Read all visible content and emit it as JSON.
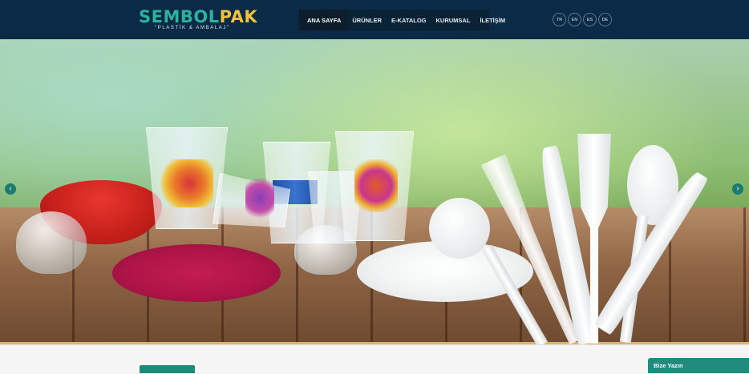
{
  "logo": {
    "name_part1": "SEMBOL",
    "name_part2": "PAK",
    "tagline": "\"PLASTİK & AMBALAJ\""
  },
  "nav": {
    "items": [
      {
        "label": "ANA SAYFA",
        "active": true
      },
      {
        "label": "ÜRÜNLER",
        "active": false
      },
      {
        "label": "E-KATALOG",
        "active": false
      },
      {
        "label": "KURUMSAL",
        "active": false
      },
      {
        "label": "İLETİŞİM",
        "active": false
      }
    ]
  },
  "languages": [
    "TR",
    "EN",
    "ES",
    "DE"
  ],
  "slider": {
    "prev_icon": "chevron-left-icon",
    "next_icon": "chevron-right-icon",
    "prev_glyph": "‹",
    "next_glyph": "›",
    "image_description_products": "plastic cups, bowls, plates, forks, knives and spoons"
  },
  "chat": {
    "label": "Bize Yazın"
  },
  "colors": {
    "header_bg": "#0b2a45",
    "accent": "#1c8b7c",
    "logo_teal": "#2bb3a0",
    "logo_gold": "#f0c23a"
  }
}
